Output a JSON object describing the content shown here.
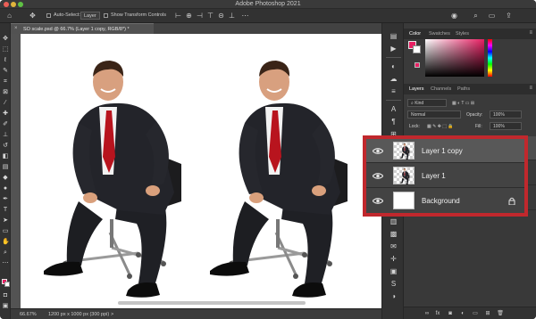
{
  "window": {
    "title": "Adobe Photoshop 2021"
  },
  "options_bar": {
    "auto_select_label": "Auto-Select:",
    "auto_select_value": "Layer",
    "show_transform_label": "Show Transform Controls"
  },
  "document": {
    "tab_title": "SO scale.psd @ 66.7% (Layer 1 copy, RGB/8*) *",
    "close_glyph": "×"
  },
  "status_bar": {
    "zoom": "66.67%",
    "doc_size": "1200 px x 1000 px (300 ppi)",
    "arrow": ">"
  },
  "colors": {
    "foreground": "#e81f63",
    "background": "#ffffff",
    "highlight_border": "#c1282d"
  },
  "color_panel": {
    "tabs": [
      "Color",
      "Swatches",
      "Styles"
    ],
    "active_tab": "Color"
  },
  "layers_panel": {
    "tabs": [
      "Layers",
      "Channels",
      "Paths"
    ],
    "active_tab": "Layers",
    "filter_label": "Kind",
    "blend_mode": "Normal",
    "opacity_label": "Opacity:",
    "opacity_value": "100%",
    "lock_label": "Lock:",
    "fill_label": "Fill:",
    "fill_value": "100%",
    "footer_fx": "fx"
  },
  "layers": [
    {
      "name": "Layer 1 copy",
      "selected": true,
      "visible": true,
      "locked": false,
      "thumb": "person"
    },
    {
      "name": "Layer 1",
      "selected": false,
      "visible": true,
      "locked": false,
      "thumb": "person"
    },
    {
      "name": "Background",
      "selected": false,
      "visible": true,
      "locked": true,
      "thumb": "white"
    }
  ]
}
